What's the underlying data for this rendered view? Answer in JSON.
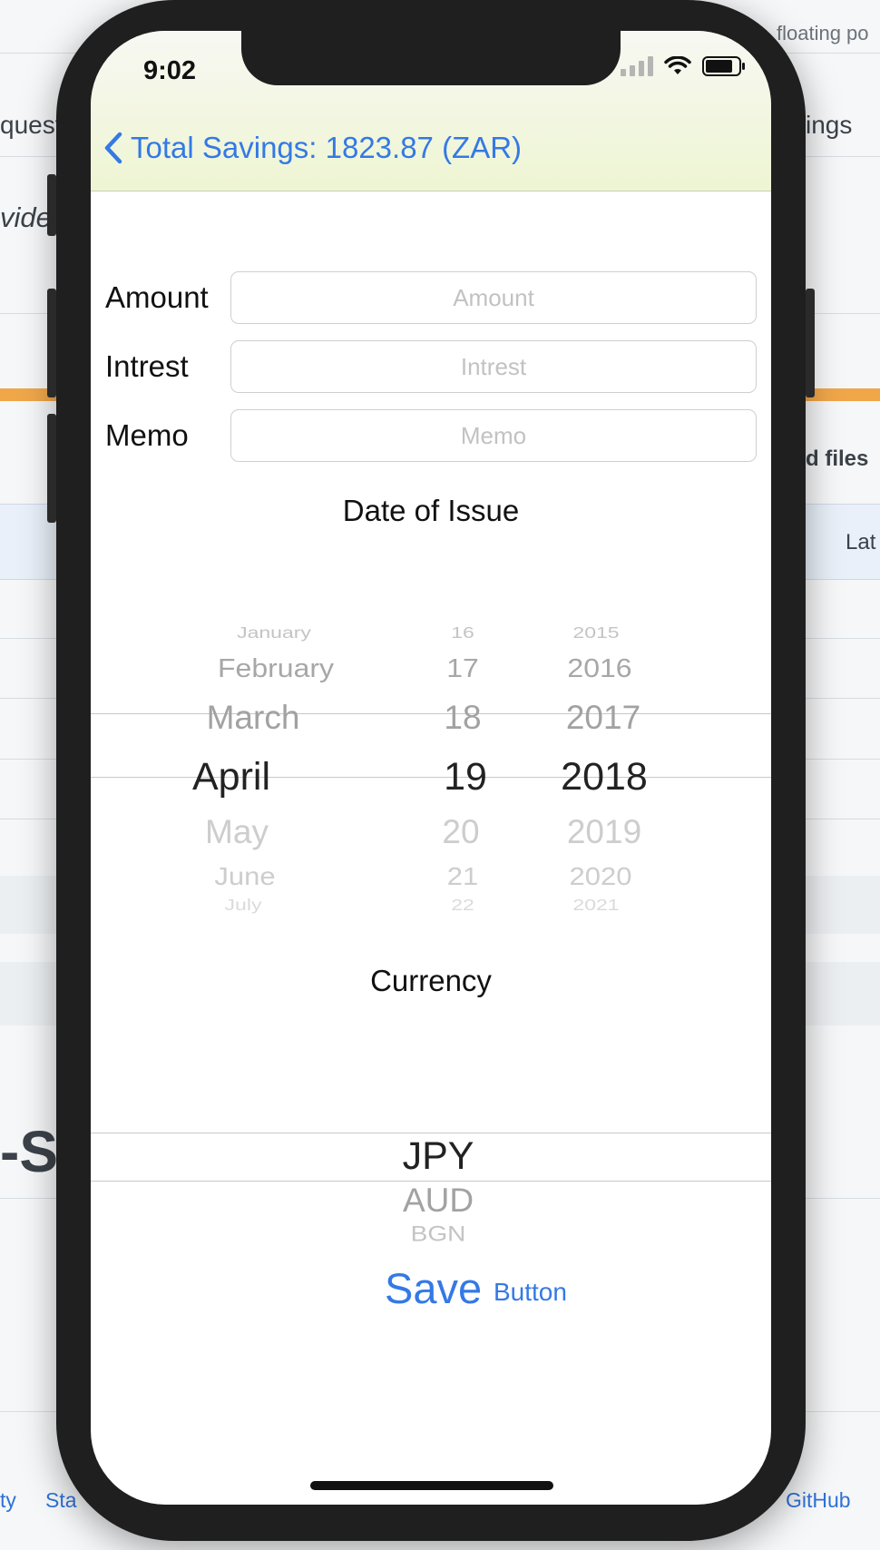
{
  "background_page": {
    "top_right_text": "floating po",
    "left_text_1": "quest",
    "right_text_1": "ings",
    "left_italic": "vide",
    "right_text_2": "d files",
    "right_text_3": "Lat",
    "big_text": "-Sa",
    "footer_left": "ty",
    "footer_left2": "Sta",
    "footer_right": "GitHub"
  },
  "status_bar": {
    "time": "9:02"
  },
  "nav": {
    "back_title": "Total Savings: 1823.87 (ZAR)"
  },
  "form": {
    "amount_label": "Amount",
    "amount_placeholder": "Amount",
    "amount_value": "",
    "interest_label": "Intrest",
    "interest_placeholder": "Intrest",
    "interest_value": "",
    "memo_label": "Memo",
    "memo_placeholder": "Memo",
    "memo_value": ""
  },
  "date_picker": {
    "title": "Date of Issue",
    "months": [
      "January",
      "February",
      "March",
      "April",
      "May",
      "June",
      "July"
    ],
    "days": [
      "16",
      "17",
      "18",
      "19",
      "20",
      "21",
      "22"
    ],
    "years": [
      "2015",
      "2016",
      "2017",
      "2018",
      "2019",
      "2020",
      "2021"
    ],
    "selected": {
      "month": "April",
      "day": "19",
      "year": "2018"
    }
  },
  "currency_picker": {
    "title": "Currency",
    "options": [
      "JPY",
      "AUD",
      "BGN"
    ],
    "selected": "JPY"
  },
  "actions": {
    "save_label": "Save",
    "button_label": "Button"
  },
  "colors": {
    "accent": "#3479e6",
    "header_gradient_bottom": "#eef5d2",
    "bg_orange": "#f0a74a"
  }
}
